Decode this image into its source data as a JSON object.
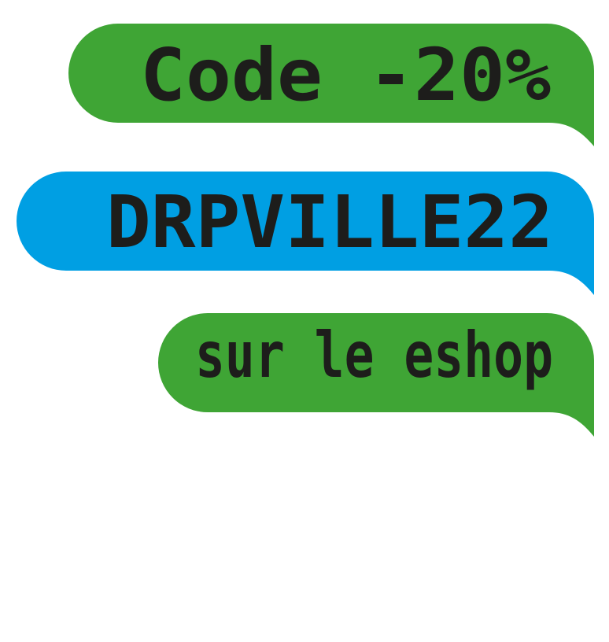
{
  "bubbles": [
    {
      "text": "Code -20%",
      "color": "#3fa535"
    },
    {
      "text": "DRPVILLE22",
      "color": "#009fe3"
    },
    {
      "text": "sur le eshop",
      "color": "#3fa535"
    }
  ],
  "text_color": "#1d1d1b"
}
